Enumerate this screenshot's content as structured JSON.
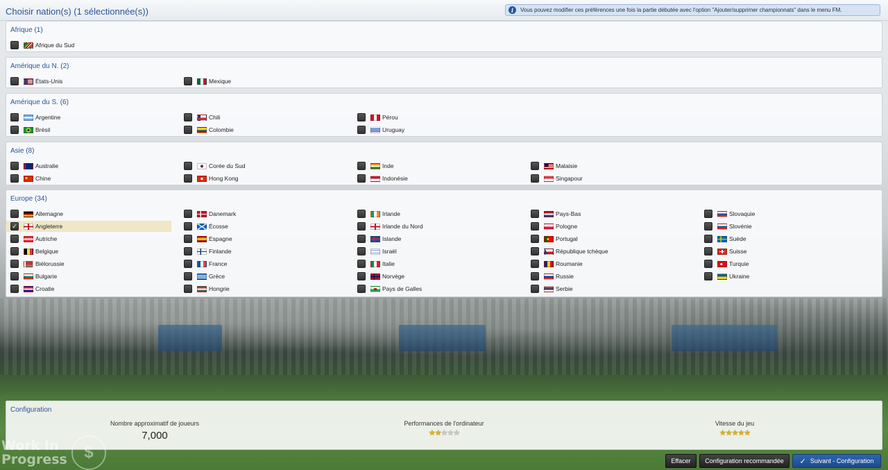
{
  "page_title": "Choisir nation(s) (1 sélectionnée(s))",
  "info_text": "Vous pouvez modifier ces préférences une fois la partie débutée avec l'option \"Ajouter/supprimer championnats\" dans le menu FM.",
  "regions": [
    {
      "title": "Afrique (1)",
      "nations": [
        {
          "name": "Afrique du Sud",
          "checked": false
        }
      ]
    },
    {
      "title": "Amérique du N. (2)",
      "nations": [
        {
          "name": "États-Unis",
          "checked": false
        },
        {
          "name": "Mexique",
          "checked": false
        }
      ]
    },
    {
      "title": "Amérique du S. (6)",
      "nations": [
        {
          "name": "Argentine",
          "checked": false
        },
        {
          "name": "Brésil",
          "checked": false
        },
        {
          "name": "Chili",
          "checked": false
        },
        {
          "name": "Colombie",
          "checked": false
        },
        {
          "name": "Pérou",
          "checked": false
        },
        {
          "name": "Uruguay",
          "checked": false
        }
      ]
    },
    {
      "title": "Asie (8)",
      "nations": [
        {
          "name": "Australie",
          "checked": false
        },
        {
          "name": "Chine",
          "checked": false
        },
        {
          "name": "Corée du Sud",
          "checked": false
        },
        {
          "name": "Hong Kong",
          "checked": false
        },
        {
          "name": "Inde",
          "checked": false
        },
        {
          "name": "Indonésie",
          "checked": false
        },
        {
          "name": "Malaisie",
          "checked": false
        },
        {
          "name": "Singapour",
          "checked": false
        }
      ]
    },
    {
      "title": "Europe (34)",
      "nations": [
        {
          "name": "Allemagne",
          "checked": false
        },
        {
          "name": "Angleterre",
          "checked": true
        },
        {
          "name": "Autriche",
          "checked": false
        },
        {
          "name": "Belgique",
          "checked": false
        },
        {
          "name": "Biélorussie",
          "checked": false
        },
        {
          "name": "Bulgarie",
          "checked": false
        },
        {
          "name": "Croatie",
          "checked": false
        },
        {
          "name": "Danemark",
          "checked": false
        },
        {
          "name": "Écosse",
          "checked": false
        },
        {
          "name": "Espagne",
          "checked": false
        },
        {
          "name": "Finlande",
          "checked": false
        },
        {
          "name": "France",
          "checked": false
        },
        {
          "name": "Grèce",
          "checked": false
        },
        {
          "name": "Hongrie",
          "checked": false
        },
        {
          "name": "Irlande",
          "checked": false
        },
        {
          "name": "Irlande du Nord",
          "checked": false
        },
        {
          "name": "Islande",
          "checked": false
        },
        {
          "name": "Israël",
          "checked": false
        },
        {
          "name": "Italie",
          "checked": false
        },
        {
          "name": "Norvège",
          "checked": false
        },
        {
          "name": "Pays de Galles",
          "checked": false
        },
        {
          "name": "Pays-Bas",
          "checked": false
        },
        {
          "name": "Pologne",
          "checked": false
        },
        {
          "name": "Portugal",
          "checked": false
        },
        {
          "name": "République tchèque",
          "checked": false
        },
        {
          "name": "Roumanie",
          "checked": false
        },
        {
          "name": "Russie",
          "checked": false
        },
        {
          "name": "Serbie",
          "checked": false
        },
        {
          "name": "Slovaquie",
          "checked": false
        },
        {
          "name": "Slovénie",
          "checked": false
        },
        {
          "name": "Suède",
          "checked": false
        },
        {
          "name": "Suisse",
          "checked": false
        },
        {
          "name": "Turquie",
          "checked": false
        },
        {
          "name": "Ukraine",
          "checked": false
        }
      ]
    }
  ],
  "configuration": {
    "title": "Configuration",
    "players_label": "Nombre approximatif de joueurs",
    "players_value": "7,000",
    "computer_label": "Performances de l'ordinateur",
    "computer_stars": 2,
    "speed_label": "Vitesse du jeu",
    "speed_stars": 4.5,
    "max_stars": 5
  },
  "watermark": {
    "line1": "Work In",
    "line2": "Progress"
  },
  "buttons": {
    "clear": "Effacer",
    "recommended": "Configuration recommandée",
    "next": "Suivant - Configuration"
  },
  "colors": {
    "title_blue": "#2a5596",
    "primary_button": "#2f66b0",
    "selected_row": "#efe7c6"
  }
}
